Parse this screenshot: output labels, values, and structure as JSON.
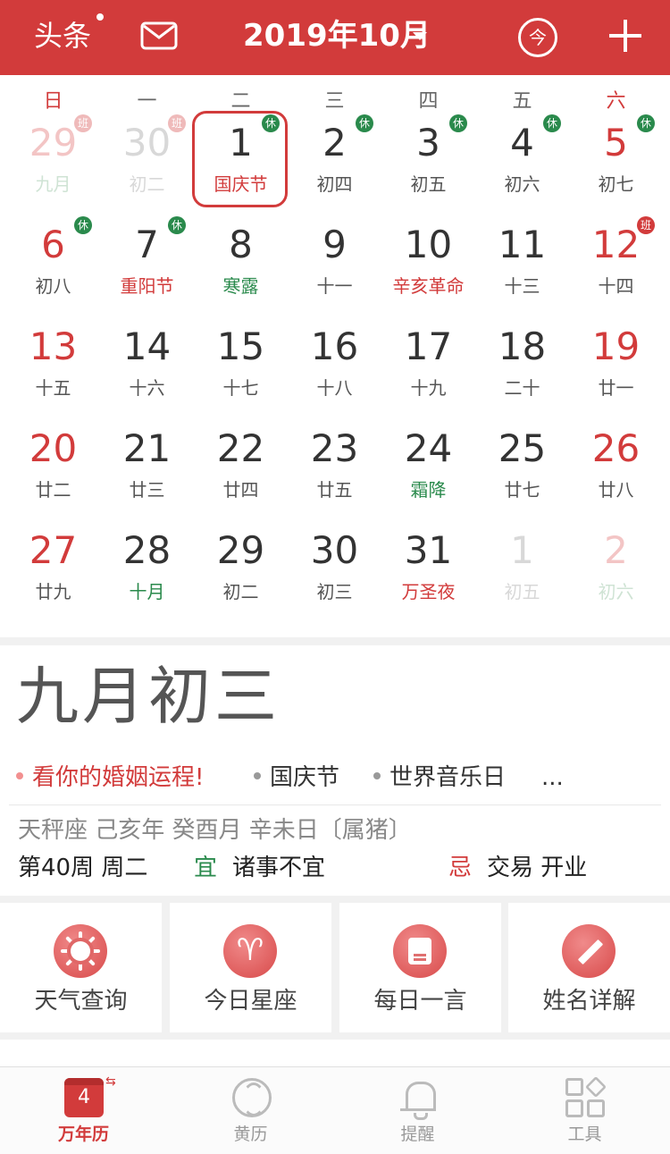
{
  "header": {
    "news_label": "头条",
    "title": "2019年10月",
    "today_label": "今"
  },
  "weekdays": [
    "日",
    "一",
    "二",
    "三",
    "四",
    "五",
    "六"
  ],
  "days": [
    {
      "n": "29",
      "l": "九月",
      "other": true,
      "badge": "班"
    },
    {
      "n": "30",
      "l": "初二",
      "other": true,
      "badge": "班"
    },
    {
      "n": "1",
      "l": "国庆节",
      "fest": true,
      "badge": "休",
      "selected": true
    },
    {
      "n": "2",
      "l": "初四",
      "badge": "休"
    },
    {
      "n": "3",
      "l": "初五",
      "badge": "休"
    },
    {
      "n": "4",
      "l": "初六",
      "badge": "休"
    },
    {
      "n": "5",
      "l": "初七",
      "badge": "休"
    },
    {
      "n": "6",
      "l": "初八",
      "badge": "休"
    },
    {
      "n": "7",
      "l": "重阳节",
      "fest": true,
      "badge": "休"
    },
    {
      "n": "8",
      "l": "寒露",
      "term": true
    },
    {
      "n": "9",
      "l": "十一"
    },
    {
      "n": "10",
      "l": "辛亥革命",
      "fest": true
    },
    {
      "n": "11",
      "l": "十三"
    },
    {
      "n": "12",
      "l": "十四",
      "badge": "班"
    },
    {
      "n": "13",
      "l": "十五"
    },
    {
      "n": "14",
      "l": "十六"
    },
    {
      "n": "15",
      "l": "十七"
    },
    {
      "n": "16",
      "l": "十八"
    },
    {
      "n": "17",
      "l": "十九"
    },
    {
      "n": "18",
      "l": "二十"
    },
    {
      "n": "19",
      "l": "廿一"
    },
    {
      "n": "20",
      "l": "廿二"
    },
    {
      "n": "21",
      "l": "廿三"
    },
    {
      "n": "22",
      "l": "廿四"
    },
    {
      "n": "23",
      "l": "廿五"
    },
    {
      "n": "24",
      "l": "霜降",
      "term": true
    },
    {
      "n": "25",
      "l": "廿七"
    },
    {
      "n": "26",
      "l": "廿八"
    },
    {
      "n": "27",
      "l": "廿九"
    },
    {
      "n": "28",
      "l": "十月",
      "term": true
    },
    {
      "n": "29",
      "l": "初二"
    },
    {
      "n": "30",
      "l": "初三"
    },
    {
      "n": "31",
      "l": "万圣夜",
      "fest": true
    },
    {
      "n": "1",
      "l": "初五",
      "other": true
    },
    {
      "n": "2",
      "l": "初六",
      "other": true
    }
  ],
  "info": {
    "lunar_date": "九月初三",
    "tags": [
      {
        "text": "看你的婚姻运程!",
        "highlight": true
      },
      {
        "text": "国庆节"
      },
      {
        "text": "世界音乐日"
      }
    ],
    "more": "...",
    "ganzhi": "天秤座  己亥年 癸酉月 辛未日〔属猪〕",
    "week": "第40周 周二",
    "yi_label": "宜",
    "yi_text": "诸事不宜",
    "ji_label": "忌",
    "ji_text": "交易 开业"
  },
  "tools": [
    {
      "label": "天气查询",
      "icon": "sun-icon"
    },
    {
      "label": "今日星座",
      "icon": "aries-icon"
    },
    {
      "label": "每日一言",
      "icon": "card-icon"
    },
    {
      "label": "姓名详解",
      "icon": "pencil-icon"
    }
  ],
  "tabbar": {
    "cal_day": "4",
    "tabs": [
      {
        "label": "万年历",
        "active": true
      },
      {
        "label": "黄历"
      },
      {
        "label": "提醒"
      },
      {
        "label": "工具"
      }
    ]
  },
  "colors": {
    "accent": "#d23b3b",
    "rest_green": "#2a8a4c"
  }
}
